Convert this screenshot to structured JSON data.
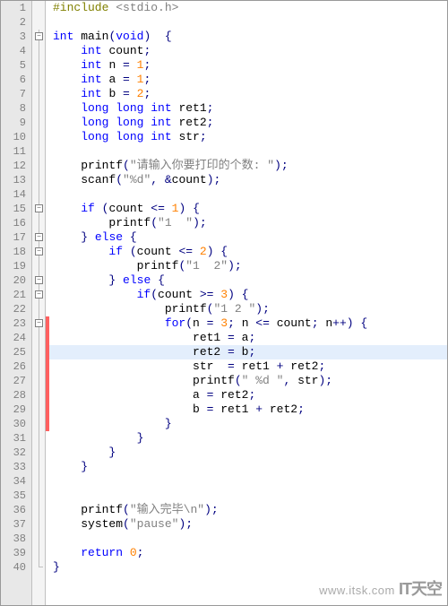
{
  "watermark": {
    "url": "www.itsk.com",
    "brand": "IT天空"
  },
  "lines": [
    {
      "n": 1,
      "fold": "",
      "chg": "",
      "tokens": [
        [
          "pp",
          "#include "
        ],
        [
          "inc",
          "<stdio.h>"
        ]
      ]
    },
    {
      "n": 2,
      "fold": "",
      "chg": "",
      "tokens": []
    },
    {
      "n": 3,
      "fold": "box",
      "chg": "",
      "tokens": [
        [
          "ty",
          "int "
        ],
        [
          "fn",
          "main"
        ],
        [
          "op",
          "("
        ],
        [
          "ty",
          "void"
        ],
        [
          "op",
          ")"
        ],
        [
          "id",
          "  "
        ],
        [
          "op",
          "{"
        ]
      ]
    },
    {
      "n": 4,
      "fold": "line",
      "chg": "",
      "tokens": [
        [
          "id",
          "    "
        ],
        [
          "ty",
          "int "
        ],
        [
          "id",
          "count"
        ],
        [
          "op",
          ";"
        ]
      ]
    },
    {
      "n": 5,
      "fold": "line",
      "chg": "",
      "tokens": [
        [
          "id",
          "    "
        ],
        [
          "ty",
          "int "
        ],
        [
          "id",
          "n "
        ],
        [
          "op",
          "= "
        ],
        [
          "num",
          "1"
        ],
        [
          "op",
          ";"
        ]
      ]
    },
    {
      "n": 6,
      "fold": "line",
      "chg": "",
      "tokens": [
        [
          "id",
          "    "
        ],
        [
          "ty",
          "int "
        ],
        [
          "id",
          "a "
        ],
        [
          "op",
          "= "
        ],
        [
          "num",
          "1"
        ],
        [
          "op",
          ";"
        ]
      ]
    },
    {
      "n": 7,
      "fold": "line",
      "chg": "",
      "tokens": [
        [
          "id",
          "    "
        ],
        [
          "ty",
          "int "
        ],
        [
          "id",
          "b "
        ],
        [
          "op",
          "= "
        ],
        [
          "num",
          "2"
        ],
        [
          "op",
          ";"
        ]
      ]
    },
    {
      "n": 8,
      "fold": "line",
      "chg": "",
      "tokens": [
        [
          "id",
          "    "
        ],
        [
          "ty",
          "long long int "
        ],
        [
          "id",
          "ret1"
        ],
        [
          "op",
          ";"
        ]
      ]
    },
    {
      "n": 9,
      "fold": "line",
      "chg": "",
      "tokens": [
        [
          "id",
          "    "
        ],
        [
          "ty",
          "long long int "
        ],
        [
          "id",
          "ret2"
        ],
        [
          "op",
          ";"
        ]
      ]
    },
    {
      "n": 10,
      "fold": "line",
      "chg": "",
      "tokens": [
        [
          "id",
          "    "
        ],
        [
          "ty",
          "long long int "
        ],
        [
          "id",
          "str"
        ],
        [
          "op",
          ";"
        ]
      ]
    },
    {
      "n": 11,
      "fold": "line",
      "chg": "",
      "tokens": []
    },
    {
      "n": 12,
      "fold": "line",
      "chg": "",
      "tokens": [
        [
          "id",
          "    "
        ],
        [
          "fn",
          "printf"
        ],
        [
          "op",
          "("
        ],
        [
          "str",
          "\"请输入你要打印的个数: \""
        ],
        [
          "op",
          ");"
        ]
      ]
    },
    {
      "n": 13,
      "fold": "line",
      "chg": "",
      "tokens": [
        [
          "id",
          "    "
        ],
        [
          "fn",
          "scanf"
        ],
        [
          "op",
          "("
        ],
        [
          "str",
          "\"%d\""
        ],
        [
          "op",
          ", &"
        ],
        [
          "id",
          "count"
        ],
        [
          "op",
          ");"
        ]
      ]
    },
    {
      "n": 14,
      "fold": "line",
      "chg": "",
      "tokens": []
    },
    {
      "n": 15,
      "fold": "box",
      "chg": "",
      "tokens": [
        [
          "id",
          "    "
        ],
        [
          "kw",
          "if"
        ],
        [
          "id",
          " "
        ],
        [
          "op",
          "("
        ],
        [
          "id",
          "count "
        ],
        [
          "op",
          "<= "
        ],
        [
          "num",
          "1"
        ],
        [
          "op",
          ") {"
        ]
      ]
    },
    {
      "n": 16,
      "fold": "line",
      "chg": "",
      "tokens": [
        [
          "id",
          "        "
        ],
        [
          "fn",
          "printf"
        ],
        [
          "op",
          "("
        ],
        [
          "str",
          "\"1  \""
        ],
        [
          "op",
          ");"
        ]
      ]
    },
    {
      "n": 17,
      "fold": "box",
      "chg": "",
      "tokens": [
        [
          "id",
          "    "
        ],
        [
          "op",
          "}"
        ],
        [
          "id",
          " "
        ],
        [
          "kw",
          "else"
        ],
        [
          "id",
          " "
        ],
        [
          "op",
          "{"
        ]
      ]
    },
    {
      "n": 18,
      "fold": "box",
      "chg": "",
      "tokens": [
        [
          "id",
          "        "
        ],
        [
          "kw",
          "if"
        ],
        [
          "id",
          " "
        ],
        [
          "op",
          "("
        ],
        [
          "id",
          "count "
        ],
        [
          "op",
          "<= "
        ],
        [
          "num",
          "2"
        ],
        [
          "op",
          ") {"
        ]
      ]
    },
    {
      "n": 19,
      "fold": "line",
      "chg": "",
      "tokens": [
        [
          "id",
          "            "
        ],
        [
          "fn",
          "printf"
        ],
        [
          "op",
          "("
        ],
        [
          "str",
          "\"1  2\""
        ],
        [
          "op",
          ");"
        ]
      ]
    },
    {
      "n": 20,
      "fold": "box",
      "chg": "",
      "tokens": [
        [
          "id",
          "        "
        ],
        [
          "op",
          "}"
        ],
        [
          "id",
          " "
        ],
        [
          "kw",
          "else"
        ],
        [
          "id",
          " "
        ],
        [
          "op",
          "{"
        ]
      ]
    },
    {
      "n": 21,
      "fold": "box",
      "chg": "",
      "tokens": [
        [
          "id",
          "            "
        ],
        [
          "kw",
          "if"
        ],
        [
          "op",
          "("
        ],
        [
          "id",
          "count "
        ],
        [
          "op",
          ">= "
        ],
        [
          "num",
          "3"
        ],
        [
          "op",
          ") {"
        ]
      ]
    },
    {
      "n": 22,
      "fold": "line",
      "chg": "",
      "tokens": [
        [
          "id",
          "                "
        ],
        [
          "fn",
          "printf"
        ],
        [
          "op",
          "("
        ],
        [
          "str",
          "\"1 2 \""
        ],
        [
          "op",
          ");"
        ]
      ]
    },
    {
      "n": 23,
      "fold": "box",
      "chg": "red",
      "tokens": [
        [
          "id",
          "                "
        ],
        [
          "kw",
          "for"
        ],
        [
          "op",
          "("
        ],
        [
          "id",
          "n "
        ],
        [
          "op",
          "= "
        ],
        [
          "num",
          "3"
        ],
        [
          "op",
          "; "
        ],
        [
          "id",
          "n "
        ],
        [
          "op",
          "<= "
        ],
        [
          "id",
          "count"
        ],
        [
          "op",
          "; "
        ],
        [
          "id",
          "n"
        ],
        [
          "op",
          "++) {"
        ]
      ]
    },
    {
      "n": 24,
      "fold": "line",
      "chg": "red",
      "tokens": [
        [
          "id",
          "                    "
        ],
        [
          "id",
          "ret1 "
        ],
        [
          "op",
          "= "
        ],
        [
          "id",
          "a"
        ],
        [
          "op",
          ";"
        ]
      ]
    },
    {
      "n": 25,
      "fold": "line",
      "chg": "red",
      "hl": true,
      "tokens": [
        [
          "id",
          "                    "
        ],
        [
          "id",
          "ret2 "
        ],
        [
          "op",
          "= "
        ],
        [
          "id",
          "b"
        ],
        [
          "op",
          ";"
        ]
      ]
    },
    {
      "n": 26,
      "fold": "line",
      "chg": "red",
      "tokens": [
        [
          "id",
          "                    "
        ],
        [
          "id",
          "str  "
        ],
        [
          "op",
          "= "
        ],
        [
          "id",
          "ret1 "
        ],
        [
          "op",
          "+ "
        ],
        [
          "id",
          "ret2"
        ],
        [
          "op",
          ";"
        ]
      ]
    },
    {
      "n": 27,
      "fold": "line",
      "chg": "red",
      "tokens": [
        [
          "id",
          "                    "
        ],
        [
          "fn",
          "printf"
        ],
        [
          "op",
          "("
        ],
        [
          "str",
          "\" %d \""
        ],
        [
          "op",
          ", "
        ],
        [
          "id",
          "str"
        ],
        [
          "op",
          ");"
        ]
      ]
    },
    {
      "n": 28,
      "fold": "line",
      "chg": "red",
      "tokens": [
        [
          "id",
          "                    "
        ],
        [
          "id",
          "a "
        ],
        [
          "op",
          "= "
        ],
        [
          "id",
          "ret2"
        ],
        [
          "op",
          ";"
        ]
      ]
    },
    {
      "n": 29,
      "fold": "line",
      "chg": "red",
      "tokens": [
        [
          "id",
          "                    "
        ],
        [
          "id",
          "b "
        ],
        [
          "op",
          "= "
        ],
        [
          "id",
          "ret1 "
        ],
        [
          "op",
          "+ "
        ],
        [
          "id",
          "ret2"
        ],
        [
          "op",
          ";"
        ]
      ]
    },
    {
      "n": 30,
      "fold": "line",
      "chg": "red",
      "tokens": [
        [
          "id",
          "                "
        ],
        [
          "op",
          "}"
        ]
      ]
    },
    {
      "n": 31,
      "fold": "line",
      "chg": "",
      "tokens": [
        [
          "id",
          "            "
        ],
        [
          "op",
          "}"
        ]
      ]
    },
    {
      "n": 32,
      "fold": "line",
      "chg": "",
      "tokens": [
        [
          "id",
          "        "
        ],
        [
          "op",
          "}"
        ]
      ]
    },
    {
      "n": 33,
      "fold": "line",
      "chg": "",
      "tokens": [
        [
          "id",
          "    "
        ],
        [
          "op",
          "}"
        ]
      ]
    },
    {
      "n": 34,
      "fold": "line",
      "chg": "",
      "tokens": []
    },
    {
      "n": 35,
      "fold": "line",
      "chg": "",
      "tokens": []
    },
    {
      "n": 36,
      "fold": "line",
      "chg": "",
      "tokens": [
        [
          "id",
          "    "
        ],
        [
          "fn",
          "printf"
        ],
        [
          "op",
          "("
        ],
        [
          "str",
          "\"输入完毕\\n\""
        ],
        [
          "op",
          ");"
        ]
      ]
    },
    {
      "n": 37,
      "fold": "line",
      "chg": "",
      "tokens": [
        [
          "id",
          "    "
        ],
        [
          "fn",
          "system"
        ],
        [
          "op",
          "("
        ],
        [
          "str",
          "\"pause\""
        ],
        [
          "op",
          ");"
        ]
      ]
    },
    {
      "n": 38,
      "fold": "line",
      "chg": "",
      "tokens": []
    },
    {
      "n": 39,
      "fold": "line",
      "chg": "",
      "tokens": [
        [
          "id",
          "    "
        ],
        [
          "kw",
          "return"
        ],
        [
          "id",
          " "
        ],
        [
          "num",
          "0"
        ],
        [
          "op",
          ";"
        ]
      ]
    },
    {
      "n": 40,
      "fold": "end",
      "chg": "",
      "tokens": [
        [
          "op",
          "}"
        ]
      ]
    }
  ]
}
